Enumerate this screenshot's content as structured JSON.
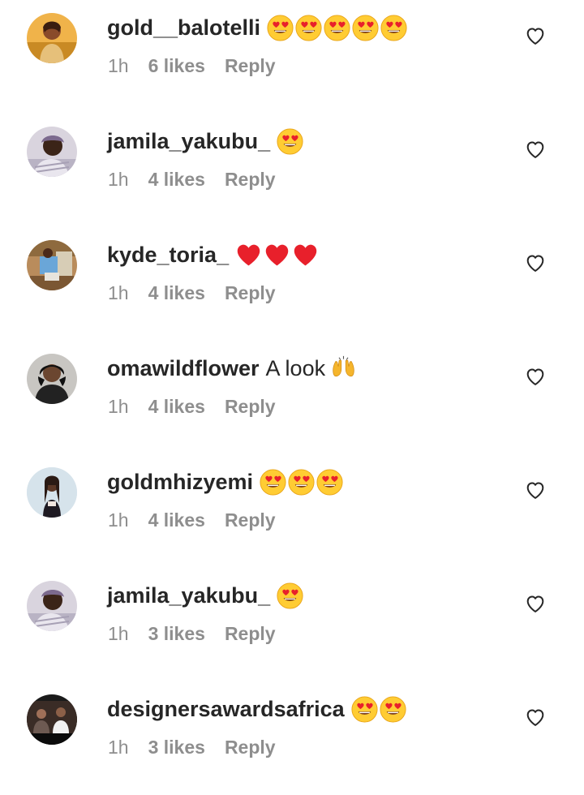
{
  "comments": [
    {
      "username": "gold__balotelli",
      "text": "",
      "emojis": [
        "heart-eyes",
        "heart-eyes",
        "heart-eyes",
        "heart-eyes",
        "heart-eyes"
      ],
      "time": "1h",
      "likes": "6 likes",
      "reply": "Reply",
      "avatar": "avatar-gold-balotelli"
    },
    {
      "username": "jamila_yakubu_",
      "text": "",
      "emojis": [
        "heart-eyes"
      ],
      "time": "1h",
      "likes": "4 likes",
      "reply": "Reply",
      "avatar": "avatar-jamila-yakubu"
    },
    {
      "username": "kyde_toria_",
      "text": "",
      "emojis": [
        "red-heart",
        "red-heart",
        "red-heart"
      ],
      "time": "1h",
      "likes": "4 likes",
      "reply": "Reply",
      "avatar": "avatar-kyde-toria"
    },
    {
      "username": "omawildflower",
      "text": "A look",
      "emojis": [
        "raising-hands"
      ],
      "time": "1h",
      "likes": "4 likes",
      "reply": "Reply",
      "avatar": "avatar-omawildflower"
    },
    {
      "username": "goldmhizyemi",
      "text": "",
      "emojis": [
        "heart-eyes",
        "heart-eyes",
        "heart-eyes"
      ],
      "time": "1h",
      "likes": "4 likes",
      "reply": "Reply",
      "avatar": "avatar-goldmhizyemi"
    },
    {
      "username": "jamila_yakubu_",
      "text": "",
      "emojis": [
        "heart-eyes"
      ],
      "time": "1h",
      "likes": "3 likes",
      "reply": "Reply",
      "avatar": "avatar-jamila-yakubu"
    },
    {
      "username": "designersawardsafrica",
      "text": "",
      "emojis": [
        "heart-eyes",
        "heart-eyes"
      ],
      "time": "1h",
      "likes": "3 likes",
      "reply": "Reply",
      "avatar": "avatar-designersawardsafrica"
    }
  ],
  "icons": {
    "like": "heart-outline-icon"
  },
  "colors": {
    "text": "#262626",
    "secondary": "#8e8e8e",
    "background": "#ffffff",
    "emoji_face": "#ffcc33",
    "emoji_heart": "#e8202b"
  }
}
